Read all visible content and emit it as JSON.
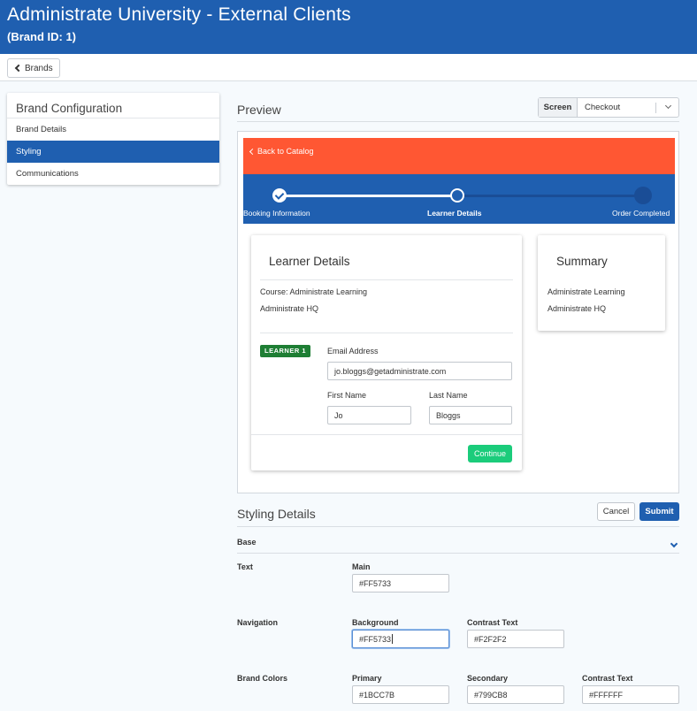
{
  "header": {
    "title": "Administrate University - External Clients",
    "subtitle": "(Brand ID: 1)"
  },
  "toolbar": {
    "back_label": "Brands"
  },
  "sidebar": {
    "title": "Brand Configuration",
    "items": [
      {
        "label": "Brand Details",
        "active": false
      },
      {
        "label": "Styling",
        "active": true
      },
      {
        "label": "Communications",
        "active": false
      }
    ]
  },
  "preview": {
    "title": "Preview",
    "screen_label": "Screen",
    "screen_value": "Checkout",
    "back_to_catalog": "Back to Catalog",
    "steps": [
      "Booking Information",
      "Learner Details",
      "Order Completed"
    ],
    "learner_card": {
      "title": "Learner Details",
      "course": "Course: Administrate Learning",
      "location": "Administrate HQ",
      "badge": "LEARNER 1",
      "email_label": "Email Address",
      "email_value": "jo.bloggs@getadministrate.com",
      "first_name_label": "First Name",
      "first_name_value": "Jo",
      "last_name_label": "Last Name",
      "last_name_value": "Bloggs",
      "continue_label": "Continue"
    },
    "summary_card": {
      "title": "Summary",
      "line1": "Administrate Learning",
      "line2": "Administrate HQ"
    }
  },
  "styling": {
    "title": "Styling Details",
    "cancel_label": "Cancel",
    "submit_label": "Submit",
    "section_label": "Base",
    "text_row": {
      "label": "Text",
      "main_label": "Main",
      "main_value": "#FF5733"
    },
    "navigation_row": {
      "label": "Navigation",
      "background_label": "Background",
      "background_value": "#FF5733",
      "contrast_label": "Contrast Text",
      "contrast_value": "#F2F2F2"
    },
    "brand_colors_row": {
      "label": "Brand Colors",
      "primary_label": "Primary",
      "primary_value": "#1BCC7B",
      "secondary_label": "Secondary",
      "secondary_value": "#799CB8",
      "contrast_label": "Contrast Text",
      "contrast_value": "#FFFFFF"
    }
  },
  "colors": {
    "brand_blue": "#1f5fb0",
    "nav_orange": "#ff5733",
    "continue_green": "#1bcc7b",
    "badge_green": "#1e7e34"
  }
}
